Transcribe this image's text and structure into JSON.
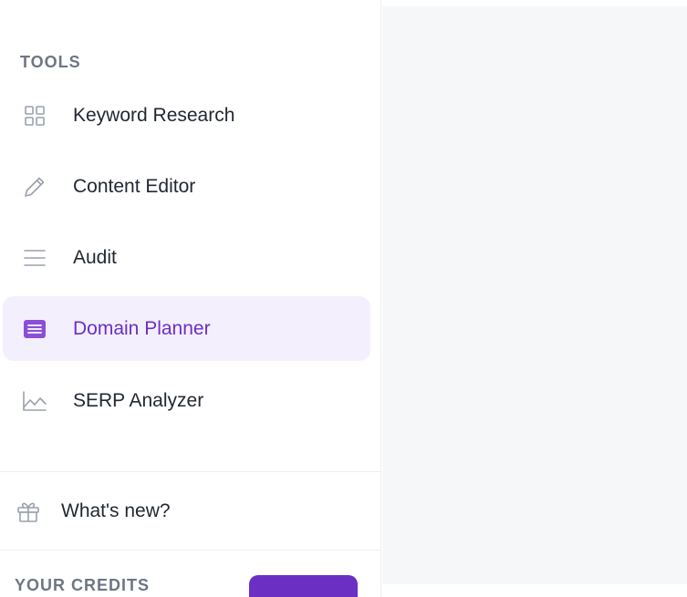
{
  "sidebar": {
    "section_label": "TOOLS",
    "items": [
      {
        "label": "Keyword Research",
        "icon": "grid-icon",
        "active": false
      },
      {
        "label": "Content Editor",
        "icon": "pencil-icon",
        "active": false
      },
      {
        "label": "Audit",
        "icon": "menu-lines-icon",
        "active": false
      },
      {
        "label": "Domain Planner",
        "icon": "document-icon",
        "active": true
      },
      {
        "label": "SERP Analyzer",
        "icon": "line-chart-icon",
        "active": false
      }
    ],
    "whats_new_label": "What's new?",
    "credits_label": "YOUR CREDITS"
  },
  "colors": {
    "accent": "#6b2fc4",
    "active_bg": "#f4effd",
    "icon": "#9aa1ad",
    "text": "#222833",
    "muted": "#6e7684",
    "main_bg": "#f6f7f9"
  }
}
